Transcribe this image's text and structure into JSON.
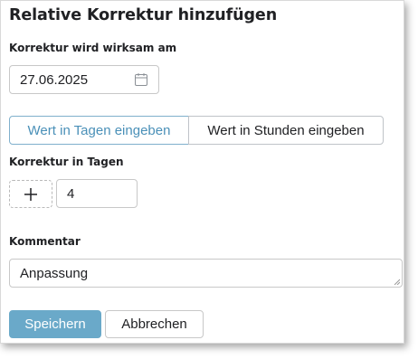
{
  "dialog": {
    "title": "Relative Korrektur hinzufügen",
    "effective_date": {
      "label": "Korrektur wird wirksam am",
      "value": "27.06.2025",
      "icon": "calendar-icon"
    },
    "mode_toggle": {
      "options": [
        "Wert in Tagen eingeben",
        "Wert in Stunden eingeben"
      ],
      "selected": "Wert in Tagen eingeben"
    },
    "correction": {
      "label": "Korrektur in Tagen",
      "sign_icon": "plus-icon",
      "value": "4"
    },
    "comment": {
      "label": "Kommentar",
      "value": "Anpassung"
    },
    "buttons": {
      "save": "Speichern",
      "cancel": "Abbrechen"
    },
    "colors": {
      "primary": "#6aa9c9",
      "selected_text": "#4a90b8",
      "selected_border": "#7fb0cc"
    }
  }
}
